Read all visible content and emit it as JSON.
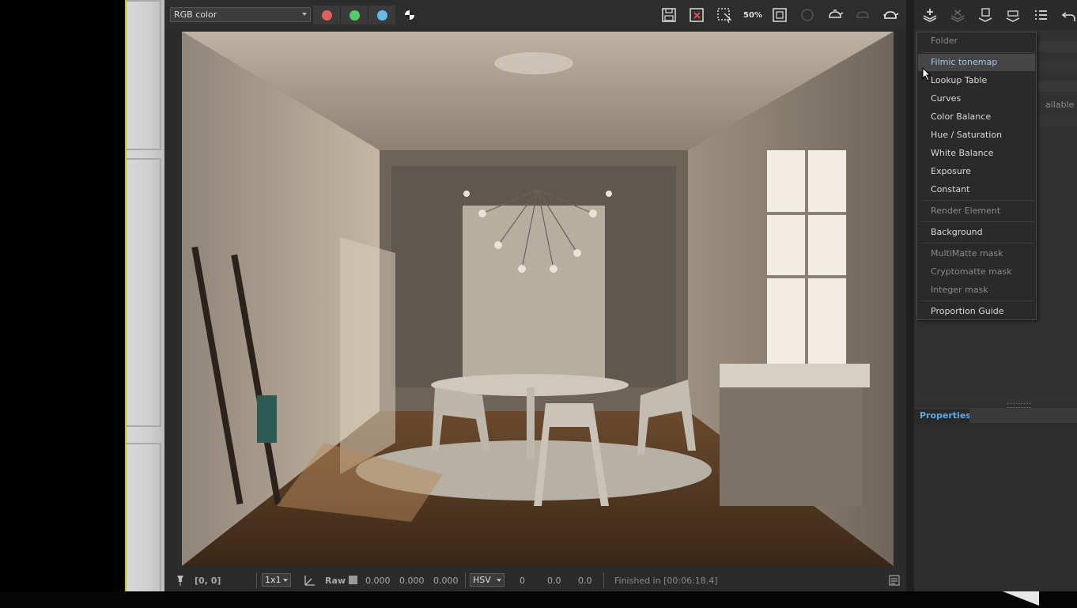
{
  "toolbar": {
    "channel_value": "RGB color",
    "channels": [
      {
        "name": "red-channel",
        "color": "#e06060"
      },
      {
        "name": "green-channel",
        "color": "#55cc66"
      },
      {
        "name": "blue-channel",
        "color": "#66bbee"
      }
    ],
    "icons": [
      "save-icon",
      "clear-image-icon",
      "region-render-icon",
      "zoom-50-icon",
      "track-mouse-icon",
      "render-icon-disabled",
      "teapot-render-icon",
      "teapot-interactive-icon-disabled",
      "teapot-icon"
    ],
    "zoom_label": "50%"
  },
  "layers_toolbar": {
    "icons": [
      "add-layer-icon",
      "remove-layer-icon",
      "save-layers-icon",
      "load-layers-icon",
      "layer-list-icon",
      "undo-icon"
    ]
  },
  "layers_panel": {
    "partial_text": "ailable"
  },
  "menu": {
    "items": [
      {
        "label": "Folder",
        "disabled": true
      },
      {
        "label": "Filmic tonemap",
        "hover": true
      },
      {
        "label": "Lookup Table"
      },
      {
        "label": "Curves"
      },
      {
        "label": "Color Balance"
      },
      {
        "label": "Hue / Saturation"
      },
      {
        "label": "White Balance"
      },
      {
        "label": "Exposure"
      },
      {
        "label": "Constant"
      },
      {
        "label": "Render Element",
        "disabled": true
      },
      {
        "label": "Background"
      },
      {
        "label": "MultiMatte mask",
        "disabled": true
      },
      {
        "label": "Cryptomatte mask",
        "disabled": true
      },
      {
        "label": "Integer mask",
        "disabled": true
      },
      {
        "label": "Proportion Guide"
      }
    ]
  },
  "properties": {
    "title": "Properties"
  },
  "statusbar": {
    "coords": "[0, 0]",
    "sample_size": "1x1",
    "raw_label": "Raw",
    "raw_r": "0.000",
    "raw_g": "0.000",
    "raw_b": "0.000",
    "color_mode": "HSV",
    "h": "0",
    "s": "0.0",
    "v": "0.0",
    "status_text": "Finished in [00:06:18.4]"
  },
  "colors": {
    "accent_blue": "#5ea9e6",
    "panel_bg": "#2b2b2b",
    "menu_hover": "#464646"
  }
}
